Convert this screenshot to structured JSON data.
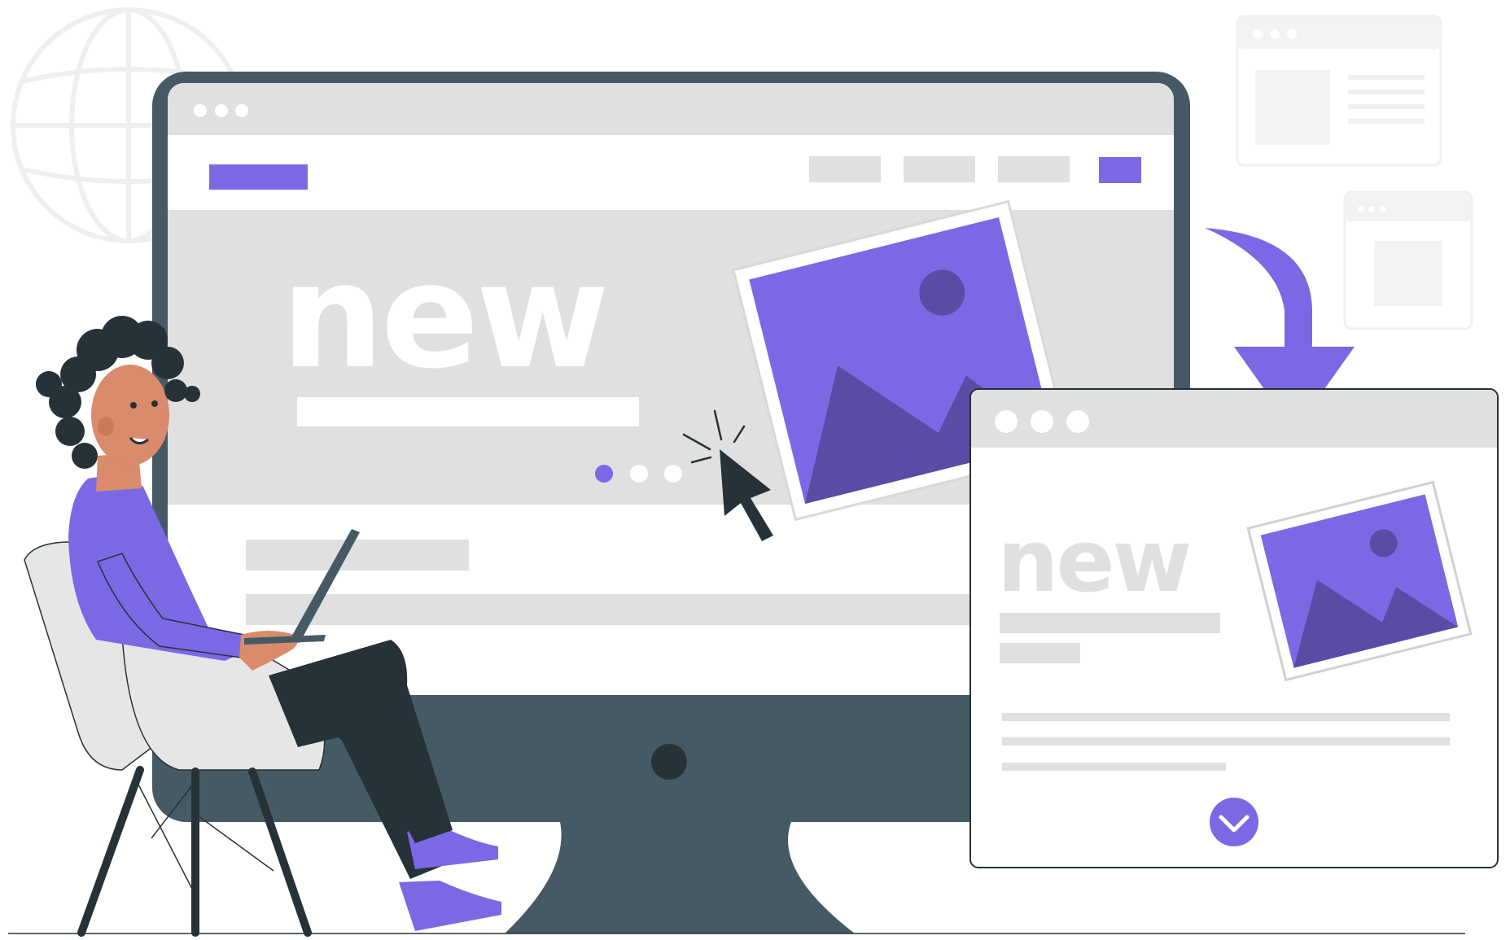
{
  "colors": {
    "accent": "#7B68E5",
    "accent_dark": "#5B4BA5",
    "monitor": "#455A64",
    "dark": "#263238",
    "light_gray": "#E0E0E0",
    "mid_gray": "#F0F0F0",
    "white": "#FFFFFF",
    "skin": "#D98B6B",
    "chair": "#E6E6E6",
    "ghost": "#F3F3F3"
  },
  "monitor": {
    "hero_text": "new"
  },
  "popup": {
    "hero_text": "new"
  },
  "icons": {
    "globe": "globe-icon",
    "cursor": "cursor-arrow-icon",
    "arrow": "curved-arrow-down-icon",
    "check": "chevron-down-icon",
    "image": "image-placeholder-icon"
  }
}
